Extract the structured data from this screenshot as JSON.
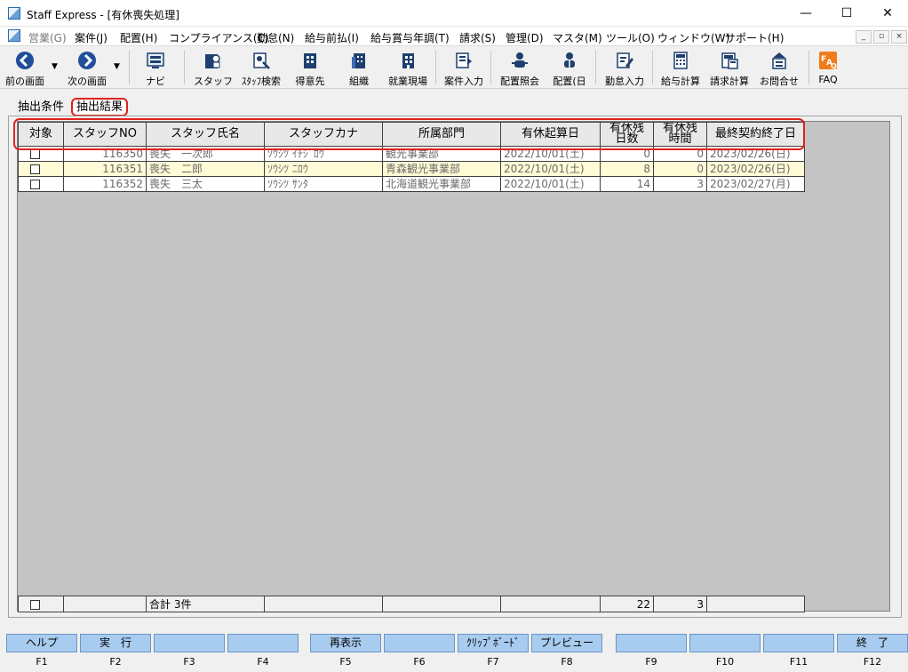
{
  "window": {
    "title": "Staff Express - [有休喪失処理]",
    "minimize": "—",
    "maximize": "☐",
    "close": "✕"
  },
  "menu": [
    {
      "label": "営業(G)",
      "disabled": true
    },
    {
      "label": "案件(J)"
    },
    {
      "label": "配置(H)"
    },
    {
      "label": "コンプライアンス(C)"
    },
    {
      "label": "勤怠(N)"
    },
    {
      "label": "給与前払(I)"
    },
    {
      "label": "給与賞与年調(T)"
    },
    {
      "label": "請求(S)"
    },
    {
      "label": "管理(D)"
    },
    {
      "label": "マスタ(M)"
    },
    {
      "label": "ツール(O)"
    },
    {
      "label": "ウィンドウ(W)"
    },
    {
      "label": "サポート(H)"
    }
  ],
  "mdi_controls": {
    "minimize": "_",
    "restore": "▫",
    "close": "×"
  },
  "toolbar": [
    {
      "label": "前の画面",
      "icon": "back-arrow-icon"
    },
    {
      "label": "次の画面",
      "icon": "forward-arrow-icon"
    },
    {
      "label": "ナビ",
      "icon": "navi-icon"
    },
    {
      "label": "スタッフ",
      "icon": "staff-icon"
    },
    {
      "label": "ｽﾀｯﾌ検索",
      "icon": "staff-search-icon"
    },
    {
      "label": "得意先",
      "icon": "customer-icon"
    },
    {
      "label": "組織",
      "icon": "organization-icon"
    },
    {
      "label": "就業現場",
      "icon": "workplace-icon"
    },
    {
      "label": "案件入力",
      "icon": "project-entry-icon"
    },
    {
      "label": "配置照会",
      "icon": "assignment-inquiry-icon"
    },
    {
      "label": "配置(日",
      "icon": "assignment-daily-icon"
    },
    {
      "label": "勤怠入力",
      "icon": "attendance-entry-icon"
    },
    {
      "label": "給与計算",
      "icon": "payroll-calc-icon"
    },
    {
      "label": "請求計算",
      "icon": "billing-calc-icon"
    },
    {
      "label": "お問合せ",
      "icon": "inquiry-icon"
    },
    {
      "label": "FAQ",
      "icon": "faq-icon"
    }
  ],
  "tabs": {
    "conditions": "抽出条件",
    "results": "抽出結果"
  },
  "grid": {
    "headers": {
      "target": "対象",
      "staff_no": "スタッフNO",
      "staff_name": "スタッフ氏名",
      "staff_kana": "スタッフカナ",
      "department": "所属部門",
      "leave_start": "有休起算日",
      "remaining_days": "有休残\n日数",
      "remaining_hours": "有休残\n時間",
      "last_contract_end": "最終契約終了日"
    },
    "rows": [
      {
        "staff_no": "116350",
        "name": "喪失　一次郎",
        "kana": "ｿｳｼﾂ ｲﾁｼﾞﾛｳ",
        "department": "観光事業部",
        "leave_start": "2022/10/01(土)",
        "days": "0",
        "hours": "0",
        "contract_end": "2023/02/26(日)"
      },
      {
        "staff_no": "116351",
        "name": "喪失　二郎",
        "kana": "ｿｳｼﾂ ﾆﾛｳ",
        "department": "青森観光事業部",
        "leave_start": "2022/10/01(土)",
        "days": "8",
        "hours": "0",
        "contract_end": "2023/02/26(日)"
      },
      {
        "staff_no": "116352",
        "name": "喪失　三太",
        "kana": "ｿｳｼﾂ ｻﾝﾀ",
        "department": "北海道観光事業部",
        "leave_start": "2022/10/01(土)",
        "days": "14",
        "hours": "3",
        "contract_end": "2023/02/27(月)"
      }
    ],
    "total": {
      "label": "合計 3件",
      "days": "22",
      "hours": "3"
    }
  },
  "fkeys": [
    {
      "label": "ヘルプ",
      "key": "F1"
    },
    {
      "label": "実　行",
      "key": "F2"
    },
    {
      "label": "",
      "key": "F3"
    },
    {
      "label": "",
      "key": "F4"
    },
    {
      "label": "再表示",
      "key": "F5"
    },
    {
      "label": "",
      "key": "F6"
    },
    {
      "label": "ｸﾘｯﾌﾟﾎﾞｰﾄﾞ",
      "key": "F7"
    },
    {
      "label": "プレビュー",
      "key": "F8"
    },
    {
      "label": "",
      "key": "F9"
    },
    {
      "label": "",
      "key": "F10"
    },
    {
      "label": "",
      "key": "F11"
    },
    {
      "label": "終　了",
      "key": "F12"
    }
  ],
  "colors": {
    "highlight": "#e0211d",
    "fkey": "#a8ccf0",
    "grid_bg": "#c4c4c4",
    "row_alt": "#fffbd6"
  }
}
